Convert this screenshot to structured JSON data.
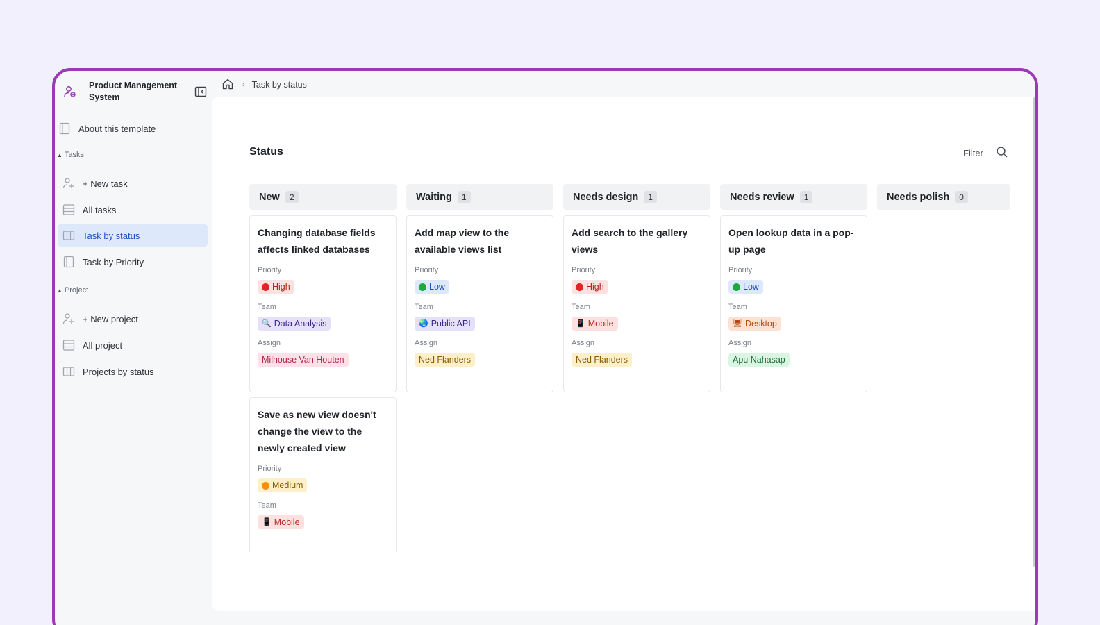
{
  "app": {
    "title": "Product Management System"
  },
  "breadcrumb": {
    "current": "Task by status"
  },
  "sidebar": {
    "about": "About this template",
    "sections": {
      "tasks": "Tasks",
      "project": "Project"
    },
    "items": [
      {
        "label": "+ New task"
      },
      {
        "label": "All tasks"
      },
      {
        "label": "Task by status"
      },
      {
        "label": "Task by Priority"
      },
      {
        "label": "+ New project"
      },
      {
        "label": "All project"
      },
      {
        "label": "Projects by status"
      }
    ]
  },
  "board": {
    "title": "Status",
    "filter_label": "Filter",
    "field_labels": {
      "priority": "Priority",
      "team": "Team",
      "assign": "Assign"
    },
    "columns": [
      {
        "name": "New",
        "count": "2"
      },
      {
        "name": "Waiting",
        "count": "1"
      },
      {
        "name": "Needs design",
        "count": "1"
      },
      {
        "name": "Needs review",
        "count": "1"
      },
      {
        "name": "Needs polish",
        "count": "0"
      }
    ],
    "cards": [
      {
        "title": "Changing database fields affects linked databases",
        "priority": "High",
        "team": "Data Analysis",
        "assign": "Milhouse Van Houten"
      },
      {
        "title": "Save as new view doesn't change the view to the newly created view",
        "priority": "Medium",
        "team": "Mobile"
      },
      {
        "title": "Add map view to the available views list",
        "priority": "Low",
        "team": "Public API",
        "assign": "Ned Flanders"
      },
      {
        "title": "Add search to the gallery views",
        "priority": "High",
        "team": "Mobile",
        "assign": "Ned Flanders"
      },
      {
        "title": "Open lookup data in a pop-up page",
        "priority": "Low",
        "team": "Desktop",
        "assign": "Apu Nahasap"
      }
    ]
  },
  "colors": {
    "frame": "#9b3ab5",
    "active_nav_bg": "#dde8fb",
    "accent": "#1f4fbf"
  }
}
